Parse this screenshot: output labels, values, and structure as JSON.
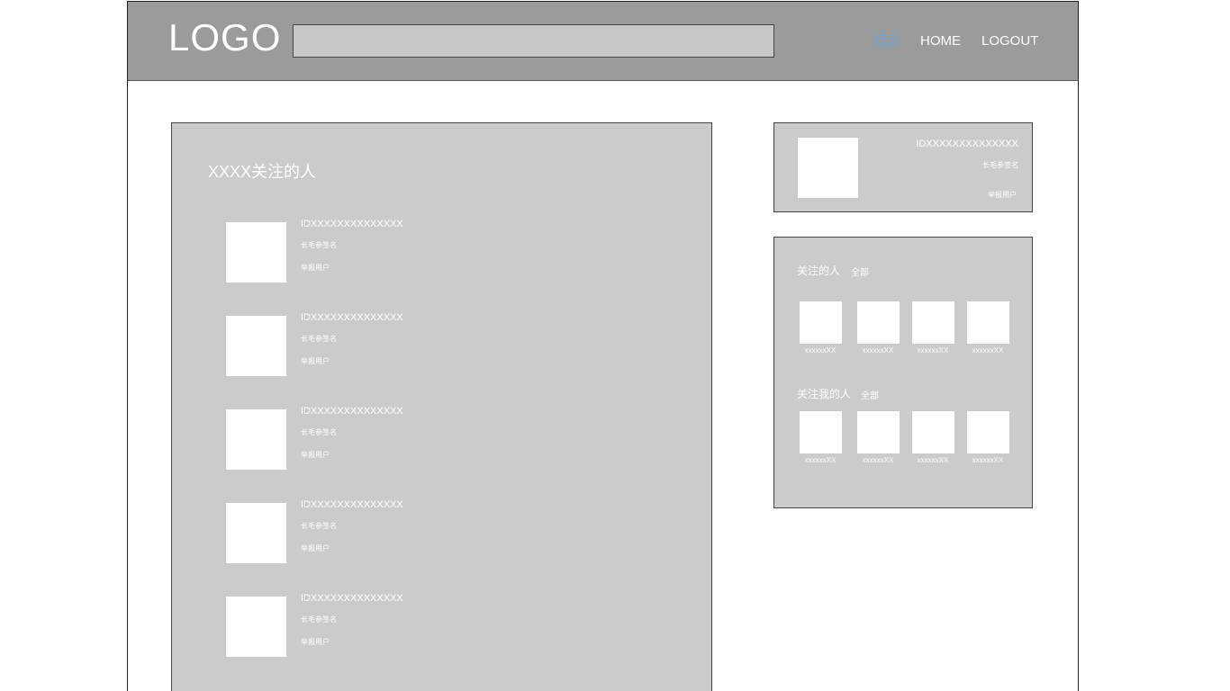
{
  "header": {
    "logo": "LOGO",
    "search_value": "",
    "nav": [
      {
        "label": "后台",
        "active": true
      },
      {
        "label": "HOME",
        "active": false
      },
      {
        "label": "LOGOUT",
        "active": false
      }
    ]
  },
  "main": {
    "title": "XXXX关注的人",
    "users": [
      {
        "id": "IDXXXXXXXXXXXXXX",
        "signature": "长毛参签名",
        "report": "举报用户"
      },
      {
        "id": "IDXXXXXXXXXXXXXX",
        "signature": "长毛参签名",
        "report": "举报用户"
      },
      {
        "id": "IDXXXXXXXXXXXXXX",
        "signature": "长毛参签名",
        "report": "举报用户"
      },
      {
        "id": "IDXXXXXXXXXXXXXX",
        "signature": "长毛参签名",
        "report": "举报用户"
      },
      {
        "id": "IDXXXXXXXXXXXXXX",
        "signature": "长毛参签名",
        "report": "举报用户"
      }
    ]
  },
  "profile": {
    "id": "IDXXXXXXXXXXXXXX",
    "signature": "长毛参签名",
    "report": "举报用户"
  },
  "following": {
    "title": "关注的人",
    "all": "全部",
    "names": [
      "xxxxxxXX",
      "xxxxxxXX",
      "xxxxxxXX",
      "xxxxxxXX"
    ]
  },
  "followers": {
    "title": "关注我的人",
    "all": "全部",
    "names": [
      "xxxxxxXX",
      "xxxxxxXX",
      "xxxxxxXX",
      "xxxxxxXX"
    ]
  },
  "colors": {
    "header_bg": "#9b9b9b",
    "panel_bg": "#cbcbcb",
    "active_nav": "#6fa3d6"
  }
}
